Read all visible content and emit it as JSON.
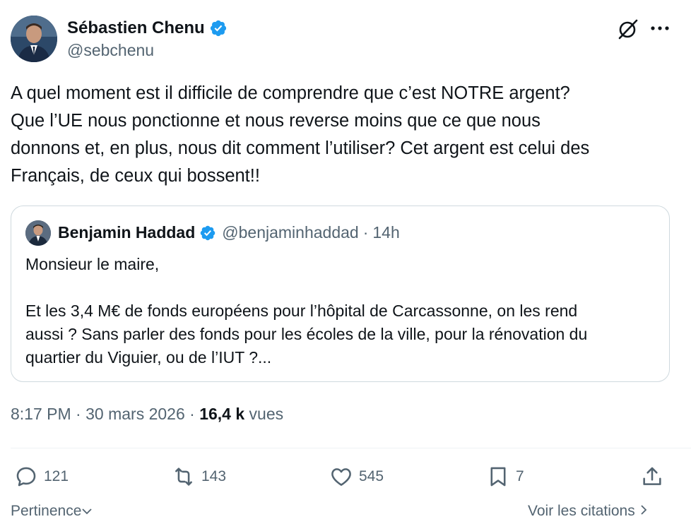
{
  "author": {
    "name": "Sébastien Chenu",
    "handle": "@sebchenu"
  },
  "tweet": {
    "text": "A quel moment est il difficile de comprendre que c’est NOTRE argent?\nQue l’UE nous ponctionne et nous reverse moins que ce que nous\ndonnons et, en plus, nous dit comment l’utiliser? Cet argent est celui des\nFrançais, de ceux qui bossent!!"
  },
  "quote": {
    "name": "Benjamin Haddad",
    "handle": "@benjaminhaddad",
    "separator": "·",
    "time": "14h",
    "text": "Monsieur le maire,\n\nEt les 3,4 M€ de fonds européens pour l’hôpital de Carcassonne, on les rend\naussi ? Sans parler des fonds pour les écoles de la ville,  pour la rénovation du\nquartier du Viguier, ou de l’IUT ?..."
  },
  "meta": {
    "time": "8:17 PM",
    "sep1": "·",
    "date": "30 mars 2026",
    "sep2": "·",
    "views_count": "16,4 k",
    "views_label": "vues"
  },
  "actions": {
    "replies": "121",
    "reposts": "143",
    "likes": "545",
    "bookmarks": "7"
  },
  "footer": {
    "sort_label": "Pertinence",
    "quotes_link": "Voir les citations"
  },
  "colors": {
    "verified_blue": "#1d9bf0",
    "muted": "#536471",
    "text": "#0f1419",
    "border": "#cfd9de"
  },
  "icons": [
    "verified-badge-icon",
    "grok-icon",
    "more-icon",
    "reply-icon",
    "repost-icon",
    "like-icon",
    "bookmark-icon",
    "share-icon",
    "chevron-down-icon",
    "chevron-right-icon"
  ]
}
